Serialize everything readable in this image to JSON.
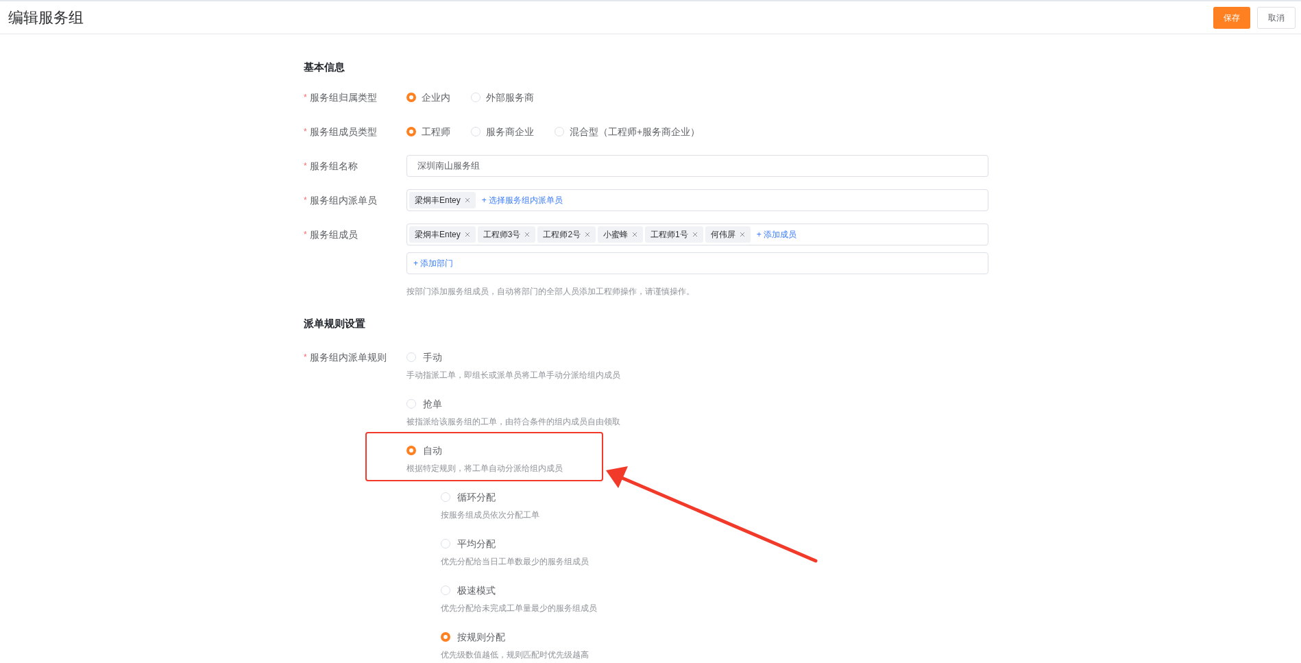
{
  "header": {
    "title": "编辑服务组",
    "buttons": [
      {
        "label": "保存",
        "kind": "primary"
      },
      {
        "label": "取消",
        "kind": "default"
      }
    ]
  },
  "basic": {
    "title": "基本信息",
    "fields": [
      {
        "kind": "radio",
        "label": "服务组归属类型",
        "required_mark": "*",
        "options": [
          {
            "label": "企业内",
            "selected": true
          },
          {
            "label": "外部服务商",
            "selected": false
          }
        ]
      },
      {
        "kind": "radio",
        "label": "服务组成员类型",
        "required_mark": "*",
        "options": [
          {
            "label": "工程师",
            "selected": true
          },
          {
            "label": "服务商企业",
            "selected": false
          },
          {
            "label": "混合型（工程师+服务商企业）",
            "selected": false
          }
        ]
      },
      {
        "kind": "text",
        "label": "服务组名称",
        "required_mark": "*",
        "value": "深圳南山服务组"
      },
      {
        "kind": "tags",
        "label": "服务组内派单员",
        "required_mark": "*",
        "tags": [
          "梁炯丰Entey"
        ],
        "add": "+ 选择服务组内派单员"
      },
      {
        "kind": "tags",
        "label": "服务组成员",
        "required_mark": "*",
        "tags": [
          "梁炯丰Entey",
          "工程师3号",
          "工程师2号",
          "小蜜蜂",
          "工程师1号",
          "何伟屏"
        ],
        "add": "+ 添加成员",
        "extra_add": "+ 添加部门",
        "hint": "按部门添加服务组成员，自动将部门的全部人员添加工程师操作，请谨慎操作。"
      }
    ]
  },
  "dispatch": {
    "title": "派单规则设置",
    "label": "服务组内派单规则",
    "required_mark": "*",
    "options": [
      {
        "label": "手动",
        "description": "手动指派工单，即组长或派单员将工单手动分派给组内成员",
        "selected": false
      },
      {
        "label": "抢单",
        "description": "被指派给该服务组的工单，由符合条件的组内成员自由领取",
        "selected": false
      },
      {
        "label": "自动",
        "description": "根据特定规则，将工单自动分派给组内成员",
        "selected": true,
        "children": [
          {
            "label": "循环分配",
            "description": "按服务组成员依次分配工单",
            "selected": false
          },
          {
            "label": "平均分配",
            "description": "优先分配给当日工单数最少的服务组成员",
            "selected": false
          },
          {
            "label": "极速模式",
            "description": "优先分配给未完成工单量最少的服务组成员",
            "selected": false
          },
          {
            "label": "按规则分配",
            "description": "优先级数值越低，规则匹配时优先级越高",
            "selected": true
          }
        ]
      }
    ]
  }
}
